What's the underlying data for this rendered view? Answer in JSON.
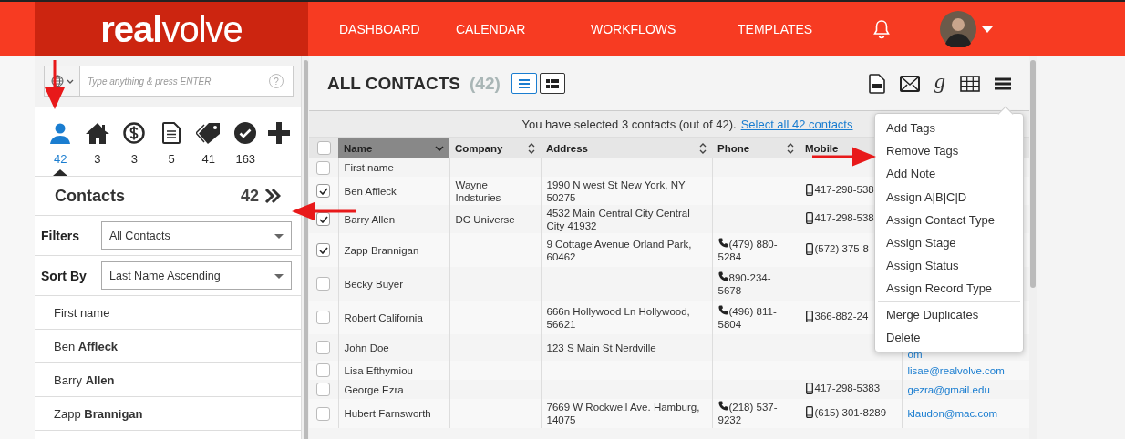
{
  "header": {
    "logo": {
      "bold": "real",
      "light": "volve"
    },
    "nav": [
      {
        "label": "DASHBOARD"
      },
      {
        "label": "CALENDAR"
      },
      {
        "label": "WORKFLOWS"
      },
      {
        "label": "TEMPLATES"
      }
    ]
  },
  "sidebar": {
    "search": {
      "placeholder": "Type anything & press ENTER",
      "help": "?"
    },
    "entity_tabs": [
      {
        "kind": "person",
        "count": "42",
        "selected": true
      },
      {
        "kind": "home",
        "count": "3",
        "selected": false
      },
      {
        "kind": "dollar",
        "count": "3",
        "selected": false
      },
      {
        "kind": "document",
        "count": "5",
        "selected": false
      },
      {
        "kind": "tag",
        "count": "41",
        "selected": false
      },
      {
        "kind": "check",
        "count": "163",
        "selected": false
      }
    ],
    "section": {
      "title": "Contacts",
      "count": "42"
    },
    "filters": {
      "label": "Filters",
      "value": "All Contacts"
    },
    "sort": {
      "label": "Sort By",
      "value": "Last Name Ascending"
    },
    "list": [
      "First name",
      "Ben **Affleck**",
      "Barry **Allen**",
      "Zapp **Brannigan**"
    ]
  },
  "main": {
    "title": "ALL CONTACTS",
    "count": "(42)",
    "views": [
      {
        "kind": "list",
        "selected": true
      },
      {
        "kind": "cards",
        "selected": false
      }
    ],
    "toolbar": [
      {
        "kind": "pdf"
      },
      {
        "kind": "mail"
      },
      {
        "kind": "text",
        "label": "g"
      },
      {
        "kind": "grid"
      },
      {
        "kind": "menu"
      }
    ],
    "selection": {
      "text": "You have selected 3 contacts (out of 42).",
      "link": "Select all 42 contacts"
    },
    "select_all": {
      "checked": false
    },
    "columns": [
      {
        "label": "Name",
        "sorted": true
      },
      {
        "label": "Company",
        "sorted": false,
        "sortable": true
      },
      {
        "label": "Address",
        "sorted": false,
        "sortable": true
      },
      {
        "label": "Phone",
        "sorted": false,
        "sortable": true
      },
      {
        "label": "Mobile",
        "sorted": false
      }
    ],
    "rows": [
      {
        "checked": false,
        "name": "First name"
      },
      {
        "checked": true,
        "name": "Ben Affleck",
        "company": "Wayne Indsturies",
        "address": "1990 N west St New York, NY 50275",
        "mobile": "417-298-538"
      },
      {
        "checked": true,
        "name": "Barry Allen",
        "company": "DC Universe",
        "address": "4532 Main Central City Central City 41932",
        "mobile": "417-298-538"
      },
      {
        "checked": true,
        "name": "Zapp Brannigan",
        "address": "9 Cottage Avenue Orland Park, 60462",
        "phone": "(479) 880-5284",
        "mobile": "(572) 375-8"
      },
      {
        "checked": false,
        "name": "Becky Buyer",
        "phone": "890-234-5678"
      },
      {
        "checked": false,
        "name": "Robert California",
        "address": "666n Hollywood Ln Hollywood, 56621",
        "phone": "(496) 811-5804",
        "mobile": "366-882-24"
      },
      {
        "checked": false,
        "name": "John Doe",
        "address": "123 S Main St Nerdville",
        "email": "om"
      },
      {
        "checked": false,
        "name": "Lisa Efthymiou",
        "email": "lisae@realvolve.com"
      },
      {
        "checked": false,
        "name": "George Ezra",
        "mobile": "417-298-5383",
        "email": "gezra@gmail.edu"
      },
      {
        "checked": false,
        "name": "Hubert Farnsworth",
        "address": "7669 W Rockwell Ave. Hamburg, 14075",
        "phone": "(218) 537-9232",
        "mobile": "(615) 301-8289",
        "email": "klaudon@mac.com"
      }
    ],
    "menu": [
      "Add Tags",
      "Remove Tags",
      "Add Note",
      "Assign A|B|C|D",
      "Assign Contact Type",
      "Assign Stage",
      "Assign Status",
      "Assign Record Type",
      "Merge Duplicates",
      "Delete"
    ]
  }
}
